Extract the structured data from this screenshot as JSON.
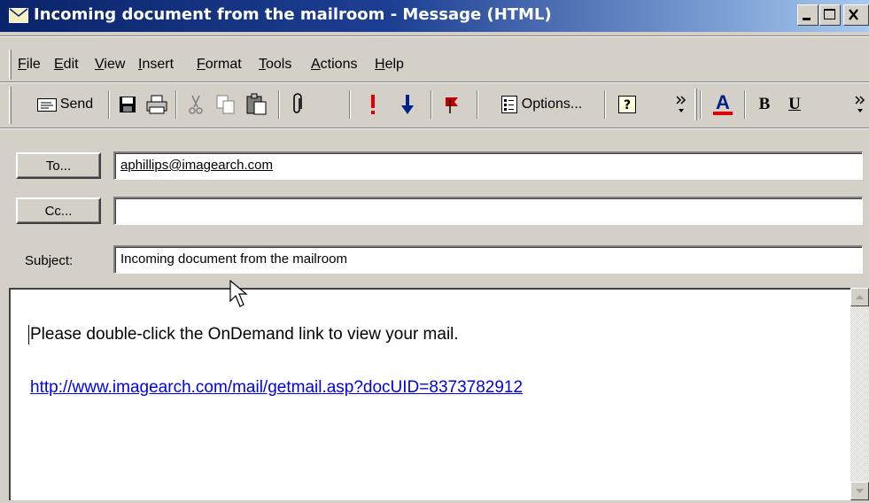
{
  "window": {
    "title": "Incoming document from the mailroom - Message (HTML)"
  },
  "menu": {
    "items": [
      "File",
      "Edit",
      "View",
      "Insert",
      "Format",
      "Tools",
      "Actions",
      "Help"
    ]
  },
  "toolbar": {
    "send_label": "Send",
    "options_label": "Options...",
    "bold_label": "B",
    "underline_label": "U",
    "icons": [
      "send-icon",
      "save-icon",
      "print-icon",
      "cut-icon",
      "copy-icon",
      "paste-icon",
      "attach-icon",
      "high-importance-icon",
      "low-importance-icon",
      "flag-icon",
      "options-icon",
      "help-icon",
      "more-icon",
      "font-color-icon",
      "bold-icon",
      "underline-icon"
    ]
  },
  "header": {
    "to_button": "To...",
    "to_value": "aphillips@imagearch.com",
    "cc_button": "Cc...",
    "cc_value": "",
    "subject_label": "Subject:",
    "subject_value": "Incoming document from the mailroom"
  },
  "body": {
    "line1": "Please double-click the OnDemand link to view your mail.",
    "link": "http://www.imagearch.com/mail/getmail.asp?docUID=8373782912"
  },
  "colors": {
    "titlebar_start": "#0a246a",
    "titlebar_end": "#a6caf0",
    "chrome": "#d4d0c8",
    "link": "#0000ee",
    "high_importance": "#e00000",
    "low_importance": "#00208a"
  }
}
